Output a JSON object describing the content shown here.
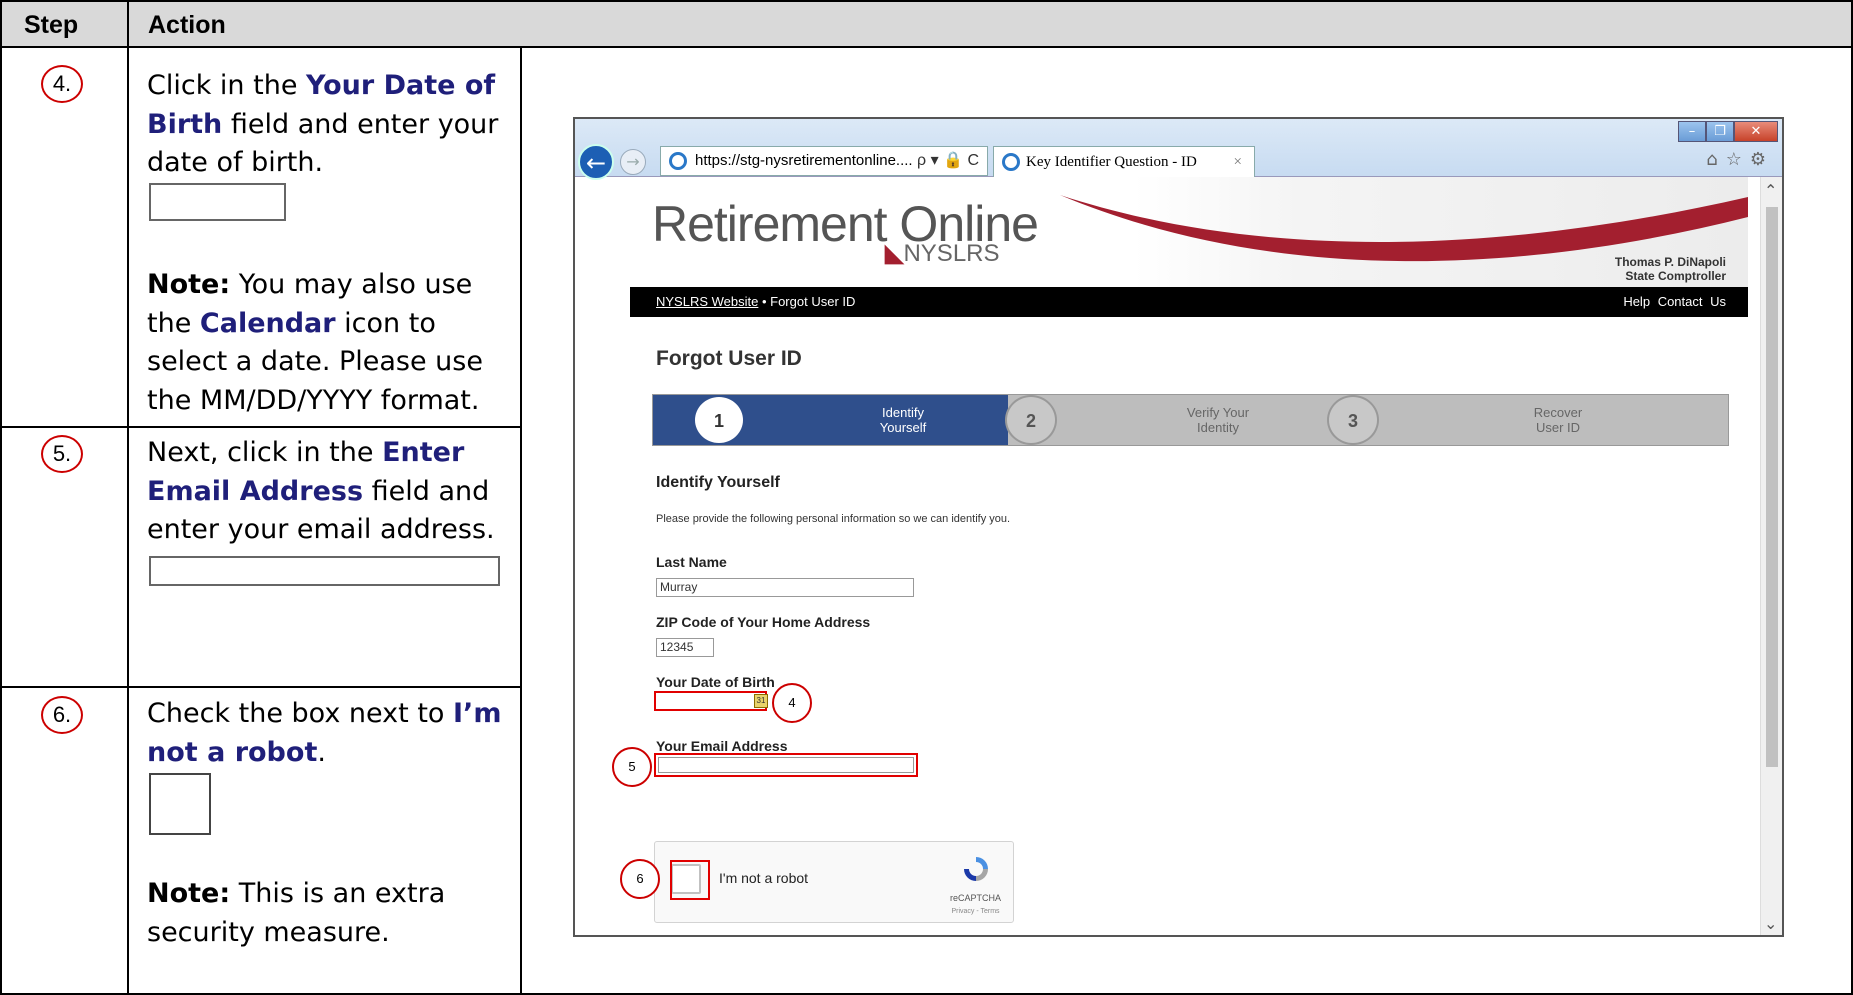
{
  "table": {
    "headers": {
      "step": "Step",
      "action": "Action"
    },
    "rows": [
      {
        "number": "4.",
        "action_parts": [
          "Click in the ",
          "Your Date of Birth",
          " field and enter your date of birth."
        ],
        "note_label": "Note:",
        "note_text": " You may also use the ",
        "note_em": "Calendar",
        "note_rest": " icon to select a date.  Please use the MM/DD/YYYY format."
      },
      {
        "number": "5.",
        "action_parts": [
          "Next, click in the ",
          "Enter Email Address",
          " field and enter your email address."
        ]
      },
      {
        "number": "6.",
        "action_parts": [
          "Check the box next to ",
          "I’m not a robot",
          "."
        ],
        "note_label": "Note:",
        "note_text": " This is an extra security measure."
      }
    ]
  },
  "browser": {
    "url": "https://stg-nysretirementonline....",
    "address_controls": "ρ ▾ 🔒 C",
    "tab_title": "Key Identifier Question - ID",
    "tab_close": "×",
    "window_buttons": [
      "–",
      "❐",
      "✕"
    ],
    "toolbar_icons": "⌂☆⚙"
  },
  "site": {
    "logo_main": "Retirement Online",
    "logo_sub": "NYSLRS",
    "comptroller_name": "Thomas P. DiNapoli",
    "comptroller_title": "State Comptroller",
    "nav_link": "NYSLRS Website",
    "nav_sep": " • ",
    "nav_current": "Forgot User ID",
    "nav_help": "Help",
    "nav_contact": "Contact Us",
    "page_title": "Forgot User ID",
    "progress": [
      {
        "number": "1",
        "label_line1": "Identify",
        "label_line2": "Yourself",
        "state": "active"
      },
      {
        "number": "2",
        "label_line1": "Verify Your",
        "label_line2": "Identity",
        "state": "inactive"
      },
      {
        "number": "3",
        "label_line1": "Recover",
        "label_line2": "User ID",
        "state": "inactive"
      }
    ],
    "section_title": "Identify Yourself",
    "intro": "Please provide the following personal information so we can identify you.",
    "fields": {
      "last_name_label": "Last Name",
      "last_name_value": "Murray",
      "zip_label": "ZIP Code of Your Home Address",
      "zip_value": "12345",
      "dob_label": "Your Date of Birth",
      "dob_value": "",
      "email_label": "Your Email Address",
      "email_value": ""
    },
    "captcha": {
      "label": "I'm not a robot",
      "brand": "reCAPTCHA",
      "links": "Privacy - Terms"
    }
  },
  "callouts": {
    "dob": "4",
    "email": "5",
    "captcha": "6"
  },
  "colors": {
    "accent_text": "#1f1f7a",
    "callout_red": "#cc0000",
    "highlight_red": "#e10000",
    "progress_active": "#2f4f8c",
    "header_gray": "#d9d9d9"
  }
}
